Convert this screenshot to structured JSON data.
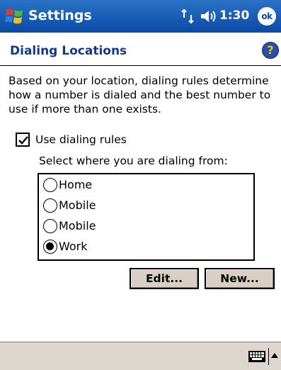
{
  "titlebar": {
    "app_title": "Settings",
    "time": "1:30",
    "ok_label": "ok"
  },
  "page": {
    "title": "Dialing Locations",
    "description": "Based on your location, dialing rules determine how a number is dialed and the best number to use if more than one exists."
  },
  "dialing_rules": {
    "checkbox_label": "Use dialing rules",
    "checked": true,
    "select_label": "Select where you are dialing from:"
  },
  "locations": [
    {
      "label": "Home",
      "selected": false
    },
    {
      "label": "Mobile",
      "selected": false
    },
    {
      "label": "Mobile",
      "selected": false
    },
    {
      "label": "Work",
      "selected": true
    }
  ],
  "buttons": {
    "edit_label": "Edit...",
    "new_label": "New..."
  },
  "icons": {
    "start": "windows-flag-icon",
    "connectivity": "connectivity-icon",
    "volume": "volume-icon",
    "help": "help-icon",
    "keyboard": "keyboard-icon",
    "sip_toggle": "up-arrow-icon"
  },
  "colors": {
    "titlebar": "#0b4aa6",
    "page_title": "#103a8a",
    "button_face": "#d8d0c4",
    "bottom_bar": "#ddd6cc"
  }
}
